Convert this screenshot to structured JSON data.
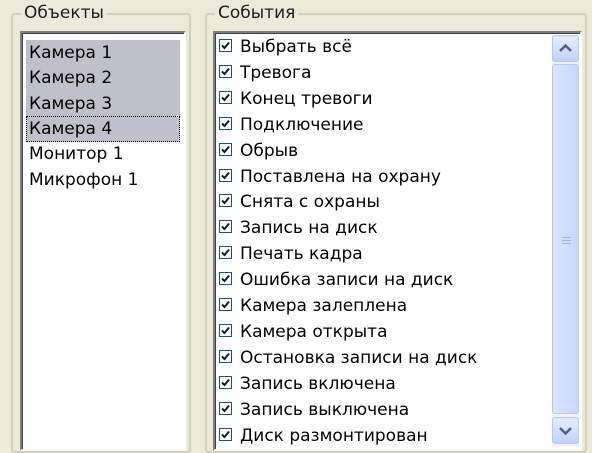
{
  "objects_group": {
    "title": "Объекты"
  },
  "events_group": {
    "title": "События"
  },
  "objects": [
    {
      "label": "Камера 1",
      "selected": true
    },
    {
      "label": "Камера 2",
      "selected": true
    },
    {
      "label": "Камера 3",
      "selected": true
    },
    {
      "label": "Камера 4",
      "selected": true,
      "focused": true
    },
    {
      "label": "Монитор 1",
      "selected": false
    },
    {
      "label": "Микрофон 1",
      "selected": false
    }
  ],
  "events": [
    {
      "label": "Выбрать всё",
      "checked": true
    },
    {
      "label": "Тревога",
      "checked": true
    },
    {
      "label": "Конец тревоги",
      "checked": true
    },
    {
      "label": "Подключение",
      "checked": true
    },
    {
      "label": "Обрыв",
      "checked": true
    },
    {
      "label": "Поставлена на охрану",
      "checked": true
    },
    {
      "label": "Снята с охраны",
      "checked": true
    },
    {
      "label": "Запись на диск",
      "checked": true
    },
    {
      "label": "Печать кадра",
      "checked": true
    },
    {
      "label": "Ошибка записи на диск",
      "checked": true
    },
    {
      "label": "Камера залеплена",
      "checked": true
    },
    {
      "label": "Камера открыта",
      "checked": true
    },
    {
      "label": "Остановка записи на диск",
      "checked": true
    },
    {
      "label": "Запись включена",
      "checked": true
    },
    {
      "label": "Запись выключена",
      "checked": true
    },
    {
      "label": "Диск размонтирован",
      "checked": true
    }
  ],
  "scrollbar": {
    "up_icon": "scroll-up-arrow",
    "down_icon": "scroll-down-arrow",
    "thumb_fraction": 0.94
  },
  "colors": {
    "selection": "#c0c0cc",
    "check": "#21a121",
    "scroll_arrow": "#4d6185"
  }
}
